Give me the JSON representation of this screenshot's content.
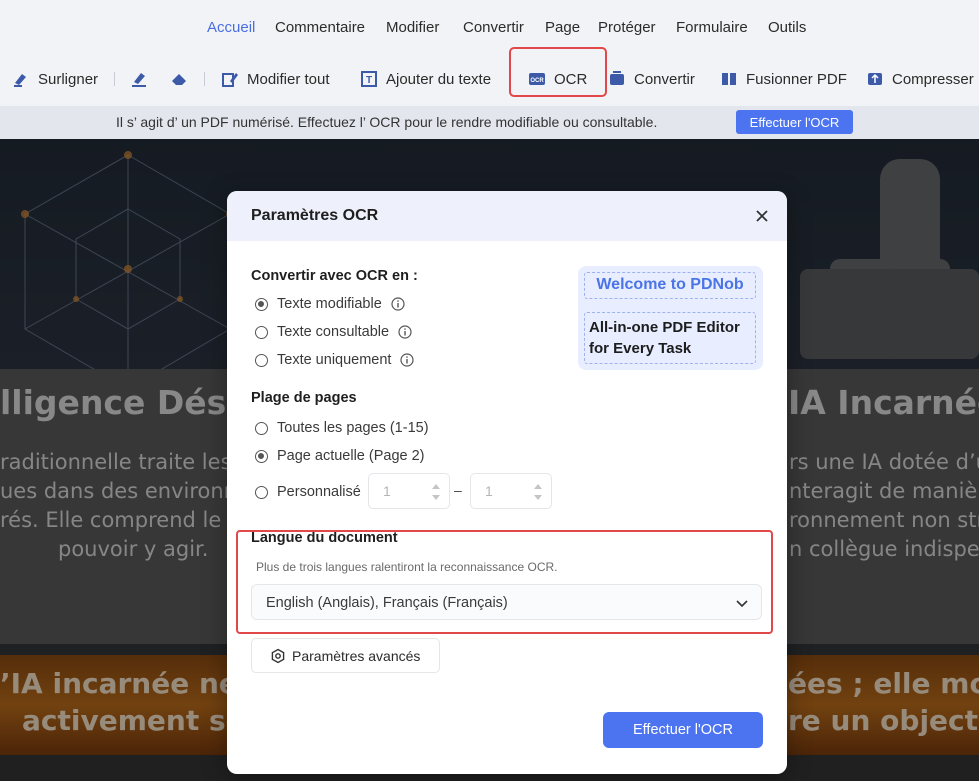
{
  "menu": {
    "items": [
      "Accueil",
      "Commentaire",
      "Modifier",
      "Convertir",
      "Page",
      "Protéger",
      "Formulaire",
      "Outils"
    ],
    "active": "Accueil"
  },
  "toolbar": {
    "surligner": "Surligner",
    "modifier_tout": "Modifier tout",
    "ajouter_texte": "Ajouter du texte",
    "ocr": "OCR",
    "convertir": "Convertir",
    "fusionner": "Fusionner PDF",
    "compresser": "Compresser F"
  },
  "banner": {
    "message": "Il s’ agit d’ un PDF numérisé. Effectuez l’ OCR pour le rendre modifiable ou consultable.",
    "button": "Effectuer l'OCR"
  },
  "document": {
    "heading_left": "lligence Dési",
    "heading_right": "IA Incarnée",
    "left_lines": [
      "raditionnelle traite les",
      "ues dans des environn",
      "rés. Elle comprend le",
      "pouvoir y agir."
    ],
    "right_lines": [
      "rs une IA dotée d’u",
      "nteragit de manière",
      "ronnement non stru",
      "n collègue indispe"
    ],
    "banner_left_1": "’IA incarnée ne s",
    "banner_left_2": "activement so",
    "banner_right_1": "ées ; elle modi",
    "banner_right_2": "re un objectif"
  },
  "dialog": {
    "title": "Paramètres OCR",
    "convert_section": "Convertir avec OCR en :",
    "convert_options": [
      {
        "label": "Texte modifiable",
        "checked": true
      },
      {
        "label": "Texte consultable",
        "checked": false
      },
      {
        "label": "Texte uniquement",
        "checked": false
      }
    ],
    "pages_section": "Plage de pages",
    "page_options": [
      {
        "label": "Toutes les pages (1-15)",
        "checked": false
      },
      {
        "label": "Page actuelle (Page 2)",
        "checked": true
      },
      {
        "label": "Personnalisé",
        "checked": false
      }
    ],
    "range_from": "1",
    "range_sep": "–",
    "range_to": "1",
    "promo_line1": "Welcome to PDNob",
    "promo_line2": "All-in-one PDF Editor for Every Task",
    "language_section": "Langue du document",
    "language_hint": "Plus de trois langues ralentiront la reconnaissance OCR.",
    "language_value": "English (Anglais), Français (Français)",
    "advanced_button": "Paramètres avancés",
    "submit_button": "Effectuer l'OCR"
  },
  "colors": {
    "accent": "#4c74f0",
    "highlight_red": "#e0484a",
    "active_menu": "#4a6ee0"
  }
}
